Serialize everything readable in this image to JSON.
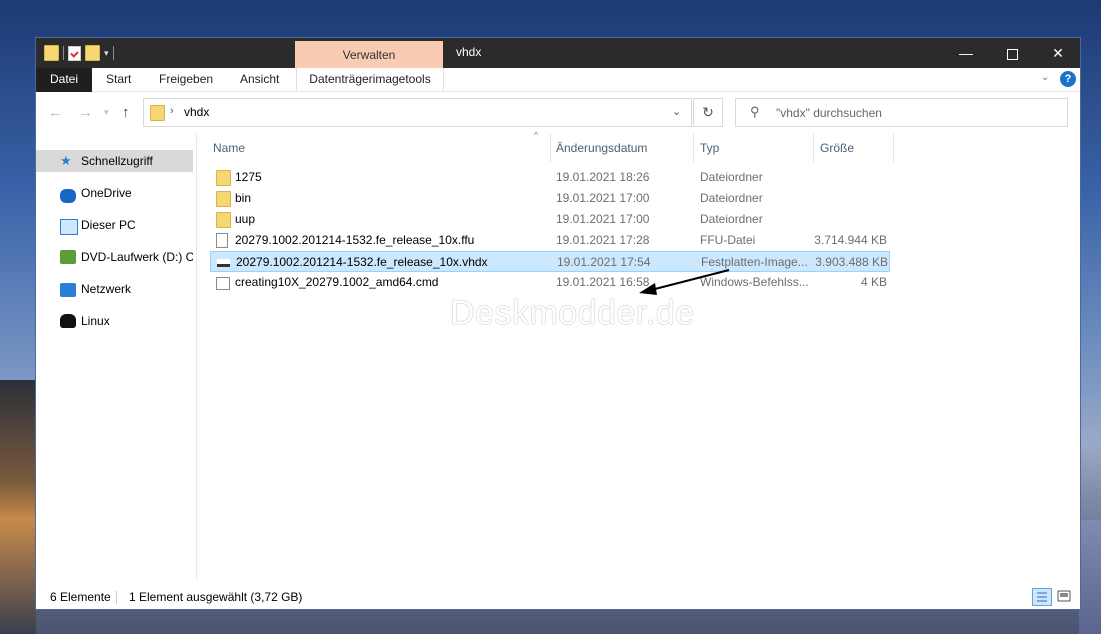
{
  "window": {
    "title": "vhdx",
    "context_tab": "Verwalten",
    "controls": {
      "minimize": "—",
      "maximize": "□",
      "close": "✕"
    }
  },
  "ribbon": {
    "tabs": [
      "Datei",
      "Start",
      "Freigeben",
      "Ansicht",
      "Datenträgerimagetools"
    ],
    "help_label": "?"
  },
  "navigation": {
    "back": "←",
    "forward": "→",
    "recent": "▾",
    "up": "↑",
    "path_separator": "›",
    "path": "vhdx",
    "refresh": "↻",
    "search_placeholder": "\"vhdx\" durchsuchen"
  },
  "sidebar": {
    "items": [
      {
        "label": "Schnellzugriff",
        "icon": "star-icon",
        "selected": true
      },
      {
        "label": "OneDrive",
        "icon": "cloud-icon"
      },
      {
        "label": "Dieser PC",
        "icon": "computer-icon"
      },
      {
        "label": "DVD-Laufwerk (D:) C(",
        "icon": "dvd-drive-icon"
      },
      {
        "label": "Netzwerk",
        "icon": "network-icon"
      },
      {
        "label": "Linux",
        "icon": "linux-penguin-icon"
      }
    ]
  },
  "columns": {
    "name": "Name",
    "date": "Änderungsdatum",
    "type": "Typ",
    "size": "Größe"
  },
  "files": [
    {
      "name": "1275",
      "date": "19.01.2021 18:26",
      "type": "Dateiordner",
      "size": "",
      "icon": "folder-icon"
    },
    {
      "name": "bin",
      "date": "19.01.2021 17:00",
      "type": "Dateiordner",
      "size": "",
      "icon": "folder-icon"
    },
    {
      "name": "uup",
      "date": "19.01.2021 17:00",
      "type": "Dateiordner",
      "size": "",
      "icon": "folder-icon"
    },
    {
      "name": "20279.1002.201214-1532.fe_release_10x.ffu",
      "date": "19.01.2021 17:28",
      "type": "FFU-Datei",
      "size": "3.714.944 KB",
      "icon": "file-icon"
    },
    {
      "name": "20279.1002.201214-1532.fe_release_10x.vhdx",
      "date": "19.01.2021 17:54",
      "type": "Festplatten-Image...",
      "size": "3.903.488 KB",
      "icon": "disk-image-icon",
      "selected": true
    },
    {
      "name": "creating10X_20279.1002_amd64.cmd",
      "date": "19.01.2021 16:58",
      "type": "Windows-Befehlss...",
      "size": "4 KB",
      "icon": "cmd-script-icon"
    }
  ],
  "watermark": "Deskmodder.de",
  "status": {
    "count": "6 Elemente",
    "selection": "1 Element ausgewählt (3,72 GB)"
  },
  "colors": {
    "accent": "#0078d7",
    "context_tab": "#f9cbb3",
    "selection": "#cce8ff"
  }
}
